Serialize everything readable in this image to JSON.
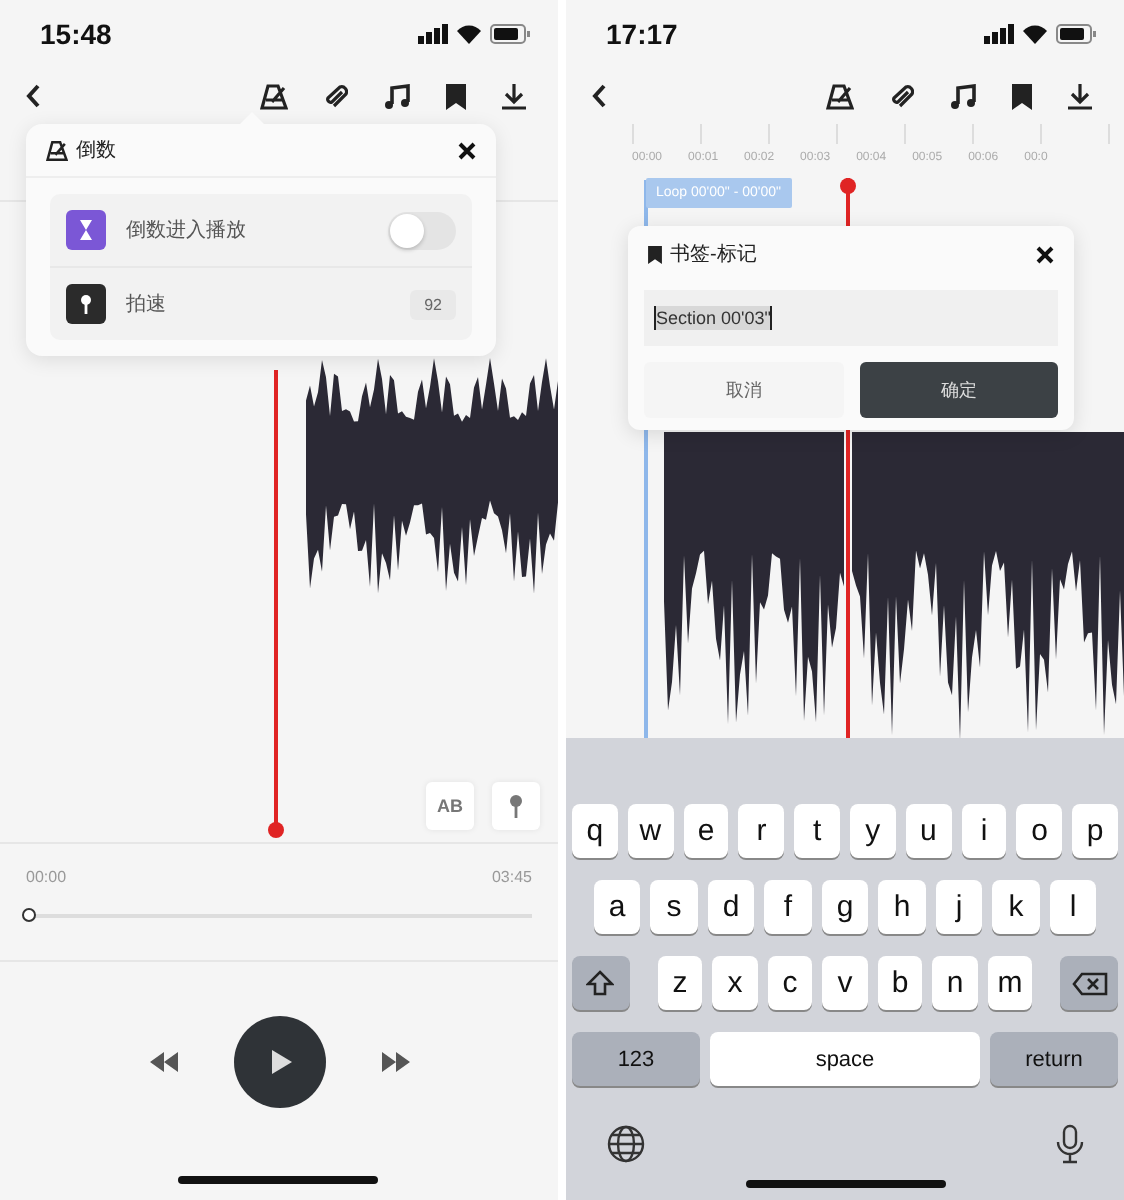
{
  "left_screen": {
    "status_bar": {
      "time": "15:48"
    },
    "popover": {
      "title": "倒数",
      "rows": [
        {
          "kind": "toggle",
          "label": "倒数进入播放",
          "on": false
        },
        {
          "kind": "value",
          "label": "拍速",
          "value": "92"
        }
      ]
    },
    "ab_button": "AB",
    "playback": {
      "elapsed": "00:00",
      "total": "03:45",
      "level": 0
    }
  },
  "right_screen": {
    "status_bar": {
      "time": "17:17"
    },
    "timeline_labels": [
      "00:00",
      "00:01",
      "00:02",
      "00:03",
      "00:04",
      "00:05",
      "00:06",
      "00:0"
    ],
    "loop_label": "Loop 00'00\" - 00'00\"",
    "dialog": {
      "title": "书签-标记",
      "input_value": "Section 00'03\"",
      "cancel": "取消",
      "confirm": "确定"
    },
    "keyboard": {
      "rows": [
        [
          "q",
          "w",
          "e",
          "r",
          "t",
          "y",
          "u",
          "i",
          "o",
          "p"
        ],
        [
          "a",
          "s",
          "d",
          "f",
          "g",
          "h",
          "j",
          "k",
          "l"
        ],
        [
          "z",
          "x",
          "c",
          "v",
          "b",
          "n",
          "m"
        ]
      ],
      "numbers": "123",
      "space": "space",
      "return": "return"
    }
  }
}
